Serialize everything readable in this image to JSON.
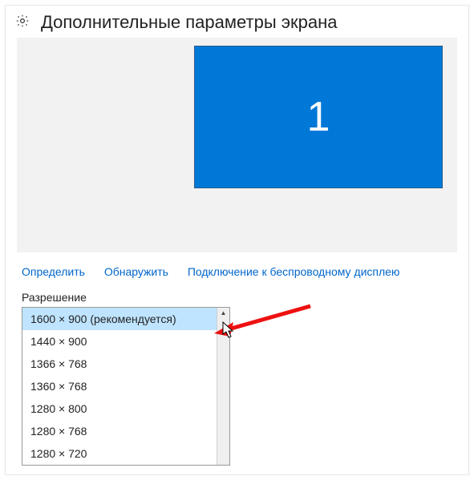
{
  "header": {
    "title": "Дополнительные параметры экрана"
  },
  "display": {
    "monitor_number": "1"
  },
  "links": {
    "identify": "Определить",
    "detect": "Обнаружить",
    "wireless": "Подключение к беспроводному дисплею"
  },
  "resolution": {
    "label": "Разрешение",
    "selected_index": 0,
    "options": [
      "1600 × 900 (рекомендуется)",
      "1440 × 900",
      "1366 × 768",
      "1360 × 768",
      "1280 × 800",
      "1280 × 768",
      "1280 × 720"
    ]
  },
  "colors": {
    "accent": "#0078d7",
    "link": "#0066cc",
    "option_highlight": "#bfe4ff"
  }
}
